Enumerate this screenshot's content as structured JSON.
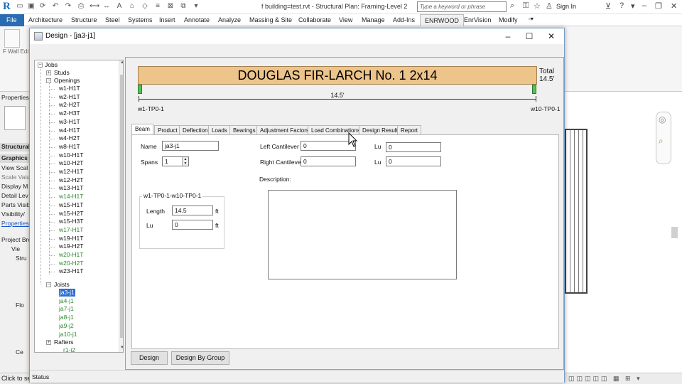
{
  "app": {
    "doc_title": "f building=test.rvt - Structural Plan: Framing-Level 2",
    "search_placeholder": "Type a keyword or phrase",
    "signin_label": "Sign In",
    "colors": {
      "accent": "#2a6cb3",
      "beam": "#edc48a",
      "support": "#55c255",
      "tree_green": "#2c8a2c",
      "selection": "#2a6fd6"
    }
  },
  "ribbon_tabs": [
    "File",
    "Architecture",
    "Structure",
    "Steel",
    "Systems",
    "Insert",
    "Annotate",
    "Analyze",
    "Massing & Site",
    "Collaborate",
    "View",
    "Manage",
    "Add-Ins",
    "ENRWOOD",
    "EnrVision",
    "Modify"
  ],
  "left_palette": {
    "wall_label": "F Wall Edi",
    "properties_header": "Properties",
    "structural": "Structural",
    "graphics": "Graphics",
    "rows": [
      "View Scal",
      "Scale Valu",
      "Display M",
      "Detail Lev",
      "Parts Visib",
      "Visibility/"
    ],
    "properties_link": "Properties",
    "project_browser": "Project Bro",
    "browser_items": [
      "Vie",
      "Stru",
      "Flo",
      "Ce"
    ]
  },
  "statusbar": {
    "text": "Click to sel"
  },
  "dialog": {
    "title": "Design - [ja3-j1]",
    "status": "Status",
    "tree": {
      "jobs": "Jobs",
      "studs": "Studs",
      "openings": "Openings",
      "opening_items": [
        {
          "label": "w1-H1T",
          "green": false
        },
        {
          "label": "w2-H1T",
          "green": false
        },
        {
          "label": "w2-H2T",
          "green": false
        },
        {
          "label": "w2-H3T",
          "green": false
        },
        {
          "label": "w3-H1T",
          "green": false
        },
        {
          "label": "w4-H1T",
          "green": false
        },
        {
          "label": "w4-H2T",
          "green": false
        },
        {
          "label": "w8-H1T",
          "green": false
        },
        {
          "label": "w10-H1T",
          "green": false
        },
        {
          "label": "w10-H2T",
          "green": false
        },
        {
          "label": "w12-H1T",
          "green": false
        },
        {
          "label": "w12-H2T",
          "green": false
        },
        {
          "label": "w13-H1T",
          "green": false
        },
        {
          "label": "w14-H1T",
          "green": true
        },
        {
          "label": "w15-H1T",
          "green": false
        },
        {
          "label": "w15-H2T",
          "green": false
        },
        {
          "label": "w15-H3T",
          "green": false
        },
        {
          "label": "w17-H1T",
          "green": true
        },
        {
          "label": "w19-H1T",
          "green": false
        },
        {
          "label": "w19-H2T",
          "green": false
        },
        {
          "label": "w20-H1T",
          "green": true
        },
        {
          "label": "w20-H2T",
          "green": true
        },
        {
          "label": "w23-H1T",
          "green": false
        }
      ],
      "joists": "Joists",
      "joist_items": [
        {
          "label": "ja3-j1",
          "selected": true
        },
        {
          "label": "ja4-j1",
          "selected": false
        },
        {
          "label": "ja7-j1",
          "selected": false
        },
        {
          "label": "ja8-j1",
          "selected": false
        },
        {
          "label": "ja9-j2",
          "selected": false
        },
        {
          "label": "ja10-j1",
          "selected": false
        }
      ],
      "rafters": "Rafters",
      "rafter_partial": "r1-j2"
    },
    "beam": {
      "title": "DOUGLAS FIR-LARCH No. 1 2x14",
      "total_label": "Total",
      "total_value": "14.5'",
      "span_label": "14.5'",
      "left_support": "w1-TP0-1",
      "right_support": "w10-TP0-1"
    },
    "tabs": [
      "Beam",
      "Product",
      "Deflection",
      "Loads",
      "Bearings",
      "Adjustment Factors",
      "Load Combinations",
      "Design Result",
      "Report"
    ],
    "active_tab": "Beam",
    "form": {
      "name_label": "Name",
      "name_value": "ja3-j1",
      "spans_label": "Spans",
      "spans_value": "1",
      "left_cant_label": "Left Cantilever",
      "left_cant_value": "0",
      "right_cant_label": "Right Cantilever",
      "right_cant_value": "0",
      "lu_label": "Lu",
      "lu_left_value": "0",
      "lu_right_value": "0",
      "description_label": "Description:",
      "group_title": "w1-TP0-1-w10-TP0-1",
      "length_label": "Length",
      "length_value": "14.5",
      "length_unit": "ft",
      "lu2_label": "Lu",
      "lu2_value": "0",
      "lu2_unit": "ft"
    },
    "buttons": {
      "design": "Design",
      "design_by_group": "Design By Group"
    }
  }
}
